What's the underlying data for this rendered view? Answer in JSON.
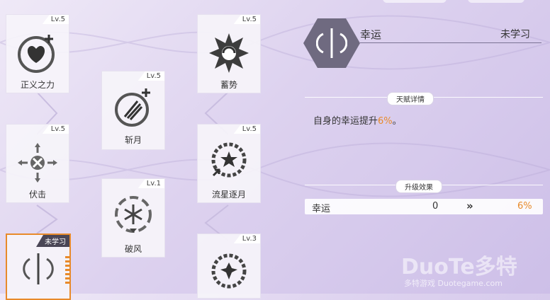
{
  "skills": {
    "justice": {
      "label": "正义之力",
      "level": "Lv.5",
      "icon": "heart-plus-icon"
    },
    "slash_moon": {
      "label": "斩月",
      "level": "Lv.5",
      "icon": "slash-plus-icon"
    },
    "ambush": {
      "label": "伏击",
      "level": "Lv.5",
      "icon": "crosshair-arrows-icon"
    },
    "break_wind": {
      "label": "破风",
      "level": "Lv.1",
      "icon": "snowflake-ring-icon"
    },
    "charge": {
      "label": "蓄势",
      "level": "Lv.5",
      "icon": "vortex-burst-icon"
    },
    "meteor_moon": {
      "label": "流星逐月",
      "level": "Lv.5",
      "icon": "gear-star-icon"
    },
    "unnamed_bottom": {
      "label": "",
      "level": "Lv.3",
      "icon": "gear-burst-icon"
    },
    "luck_selected": {
      "status": "未学习",
      "icon": "sword-arcs-icon"
    }
  },
  "detail": {
    "name": "幸运",
    "status": "未学习",
    "icon": "sword-arcs-icon",
    "section_talent": "天赋详情",
    "description_prefix": "自身的幸运提升",
    "description_value": "6%",
    "description_suffix": "。",
    "section_upgrade": "升级效果",
    "upgrade_stat": "幸运",
    "upgrade_current": "0",
    "upgrade_arrow": "»",
    "upgrade_next": "6%"
  },
  "watermark": {
    "brand": "DuoTe多特",
    "sub": "多特游戏 Duotegame.com"
  },
  "colors": {
    "accent": "#e88a2a",
    "dark": "#4a4656",
    "line": "#7b7394"
  }
}
